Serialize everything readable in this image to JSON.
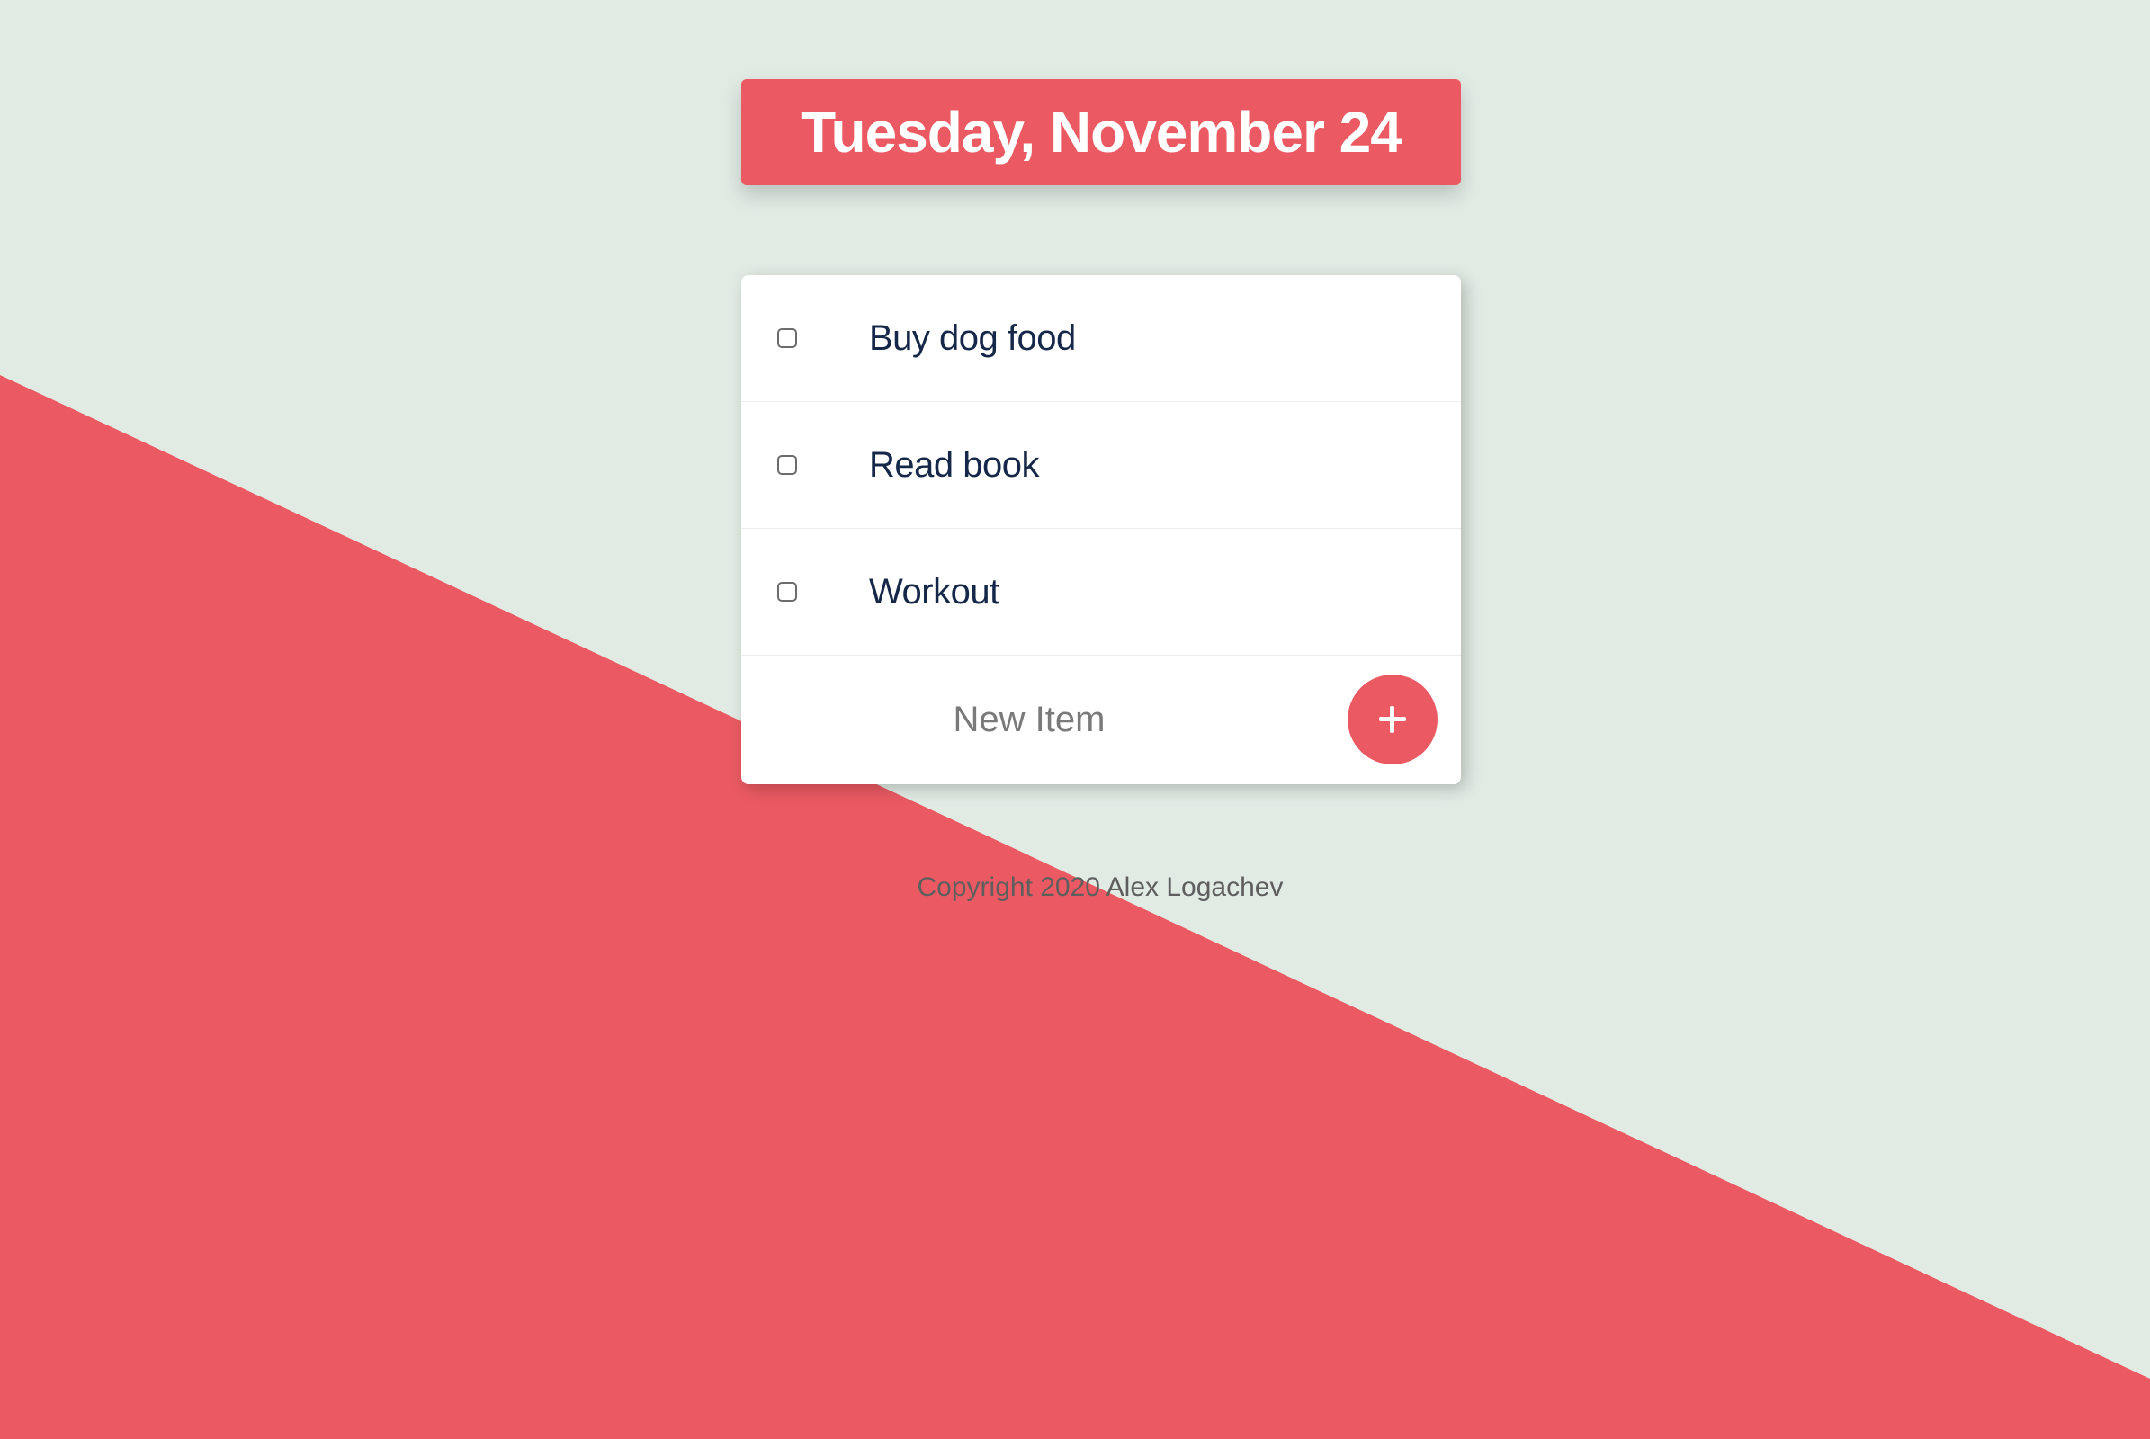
{
  "header": {
    "date": "Tuesday, November 24"
  },
  "todo": {
    "items": [
      {
        "label": "Buy dog food",
        "checked": false
      },
      {
        "label": "Read book",
        "checked": false
      },
      {
        "label": "Workout",
        "checked": false
      }
    ],
    "new_item_placeholder": "New Item",
    "add_button_icon": "plus-icon"
  },
  "footer": {
    "copyright": "Copyright 2020 Alex Logachev"
  },
  "colors": {
    "accent": "#EB5A62",
    "background": "#E1EBE4",
    "item_text": "#16284A"
  }
}
